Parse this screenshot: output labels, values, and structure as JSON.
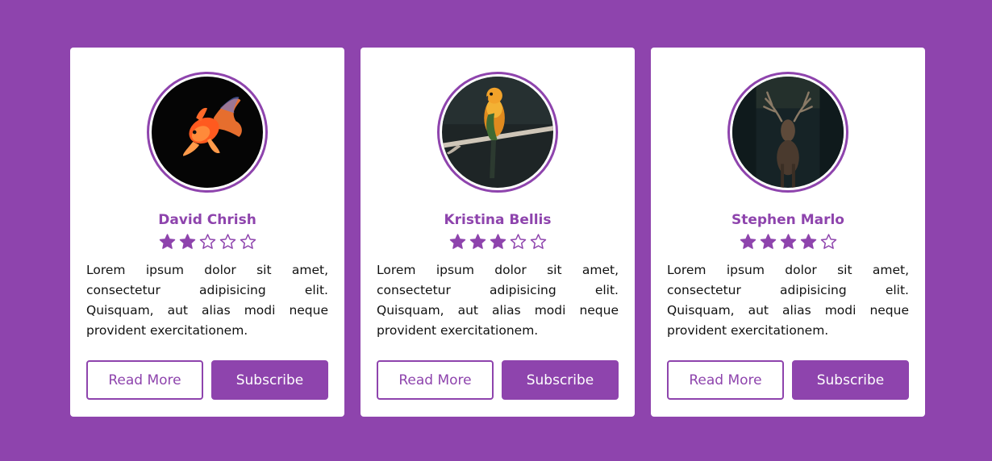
{
  "colors": {
    "background": "#8e44ad",
    "accent": "#8e44ad",
    "card": "#ffffff",
    "text": "#111111"
  },
  "cards": [
    {
      "name": "David Chrish",
      "avatar_icon": "goldfish-photo",
      "rating": 2,
      "rating_max": 5,
      "description": "Lorem ipsum dolor sit amet, consectetur adipisicing elit. Quisquam, aut alias modi neque provident exercitationem.",
      "read_more_label": "Read More",
      "subscribe_label": "Subscribe"
    },
    {
      "name": "Kristina Bellis",
      "avatar_icon": "parrot-photo",
      "rating": 3,
      "rating_max": 5,
      "description": "Lorem ipsum dolor sit amet, consectetur adipisicing elit. Quisquam, aut alias modi neque provident exercitationem.",
      "read_more_label": "Read More",
      "subscribe_label": "Subscribe"
    },
    {
      "name": "Stephen Marlo",
      "avatar_icon": "deer-photo",
      "rating": 4,
      "rating_max": 5,
      "description": "Lorem ipsum dolor sit amet, consectetur adipisicing elit. Quisquam, aut alias modi neque provident exercitationem.",
      "read_more_label": "Read More",
      "subscribe_label": "Subscribe"
    }
  ]
}
